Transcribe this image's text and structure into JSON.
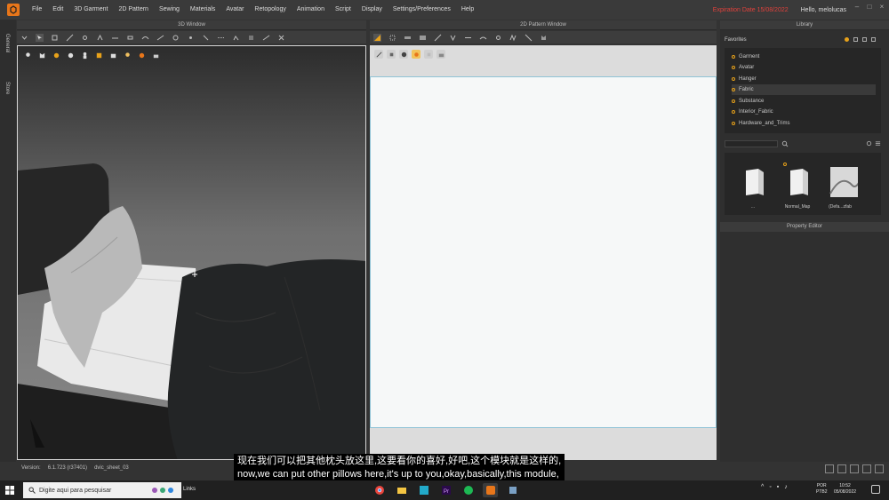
{
  "menu": {
    "items": [
      "File",
      "Edit",
      "3D Garment",
      "2D Pattern",
      "Sewing",
      "Materials",
      "Avatar",
      "Retopology",
      "Animation",
      "Script",
      "Display",
      "Settings/Preferences",
      "Help"
    ],
    "expiration": "Expiration Date 15/08/2022",
    "hello_prefix": "Hello,",
    "user": "melolucas"
  },
  "left_tabs": [
    "General",
    "Store"
  ],
  "panels": {
    "window3d_title": "3D Window",
    "window2d_title": "2D Pattern Window",
    "library_title": "Library",
    "property_editor_title": "Property Editor"
  },
  "library": {
    "favorites_label": "Favorites",
    "items": [
      "Garment",
      "Avatar",
      "Hanger",
      "Fabric",
      "Substance",
      "Interior_Fabric",
      "Hardware_and_Trims"
    ],
    "selected": "Fabric",
    "thumbnails": [
      {
        "label": "..."
      },
      {
        "label": "Normal_Map"
      },
      {
        "label": "(Defa...zfab"
      }
    ]
  },
  "status": {
    "version_label": "Version:",
    "version": "6.1.723 (r37401)",
    "file": "dvic_sheet_03"
  },
  "subtitle": {
    "zh": "现在我们可以把其他枕头放这里,这要看你的喜好,好吧,这个模块就是这样的,",
    "en": "now,we can put other pillows here,it's up to you,okay,basically,this module,"
  },
  "taskbar": {
    "search_placeholder": "Digite aqui para pesquisar",
    "links": "Links",
    "lang1": "POR",
    "lang2": "PTB2",
    "time": "10:52",
    "date": "05/08/2022"
  },
  "colors": {
    "accent": "#e8761a",
    "expiry": "#e0413c",
    "pattern_border": "#8fc3d6"
  }
}
